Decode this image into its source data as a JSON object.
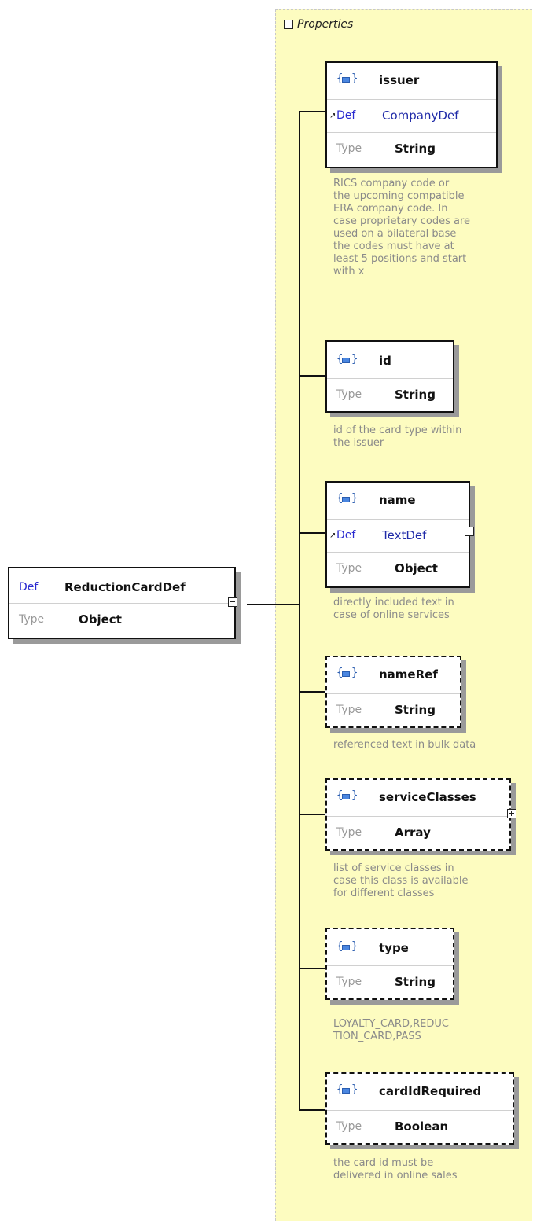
{
  "panel": {
    "title": "Properties"
  },
  "root": {
    "def_keyword": "Def",
    "name": "ReductionCardDef",
    "type_keyword": "Type",
    "type": "Object"
  },
  "properties": [
    {
      "name": "issuer",
      "def_keyword": "Def",
      "def": "CompanyDef",
      "type_keyword": "Type",
      "type": "String",
      "description": "RICS company code or\nthe upcoming compatible\nERA company code. In\ncase proprietary codes are\nused on a bilateral base\nthe  codes must have at\nleast 5 positions and start\nwith x"
    },
    {
      "name": "id",
      "type_keyword": "Type",
      "type": "String",
      "description": "id of the card type within\nthe issuer"
    },
    {
      "name": "name",
      "def_keyword": "Def",
      "def": "TextDef",
      "type_keyword": "Type",
      "type": "Object",
      "description": "directly included text in\ncase of online services"
    },
    {
      "name": "nameRef",
      "type_keyword": "Type",
      "type": "String",
      "description": "referenced text in bulk data"
    },
    {
      "name": "serviceClasses",
      "type_keyword": "Type",
      "type": "Array",
      "description": "list of service classes in\ncase this class is available\nfor different classes"
    },
    {
      "name": "type",
      "type_keyword": "Type",
      "type": "String",
      "description": "LOYALTY_CARD,REDUC\nTION_CARD,PASS"
    },
    {
      "name": "cardIdRequired",
      "type_keyword": "Type",
      "type": "Boolean",
      "description": "the card id must be\ndelivered in online sales"
    }
  ],
  "icons": {
    "expand": "plus-box-icon",
    "collapse": "minus-box-icon",
    "element": "element-icon",
    "reference": "reference-arrow-icon"
  }
}
